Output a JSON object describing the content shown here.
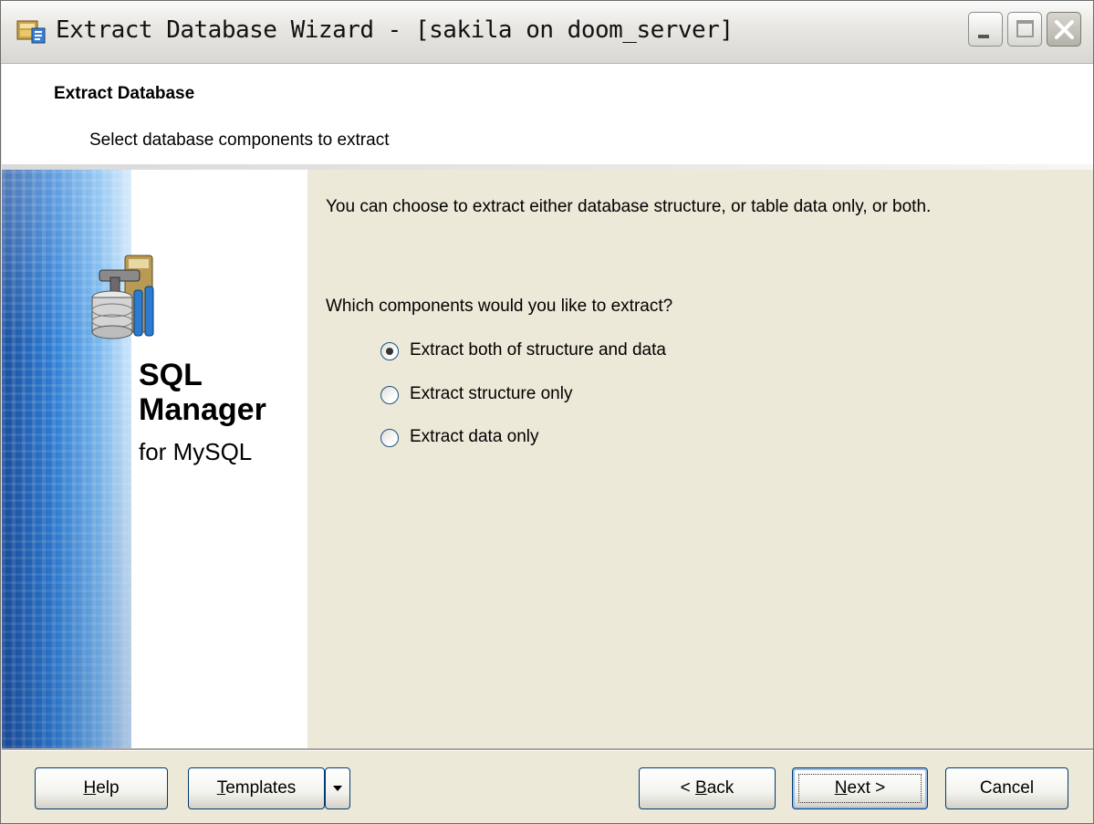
{
  "window": {
    "title": "Extract Database Wizard - [sakila on doom_server]"
  },
  "header": {
    "title": "Extract Database",
    "subtitle": "Select database components to extract"
  },
  "sidebar": {
    "logo_line1": "SQL",
    "logo_line2": "Manager",
    "logo_line3": "for MySQL"
  },
  "content": {
    "intro": "You can choose to extract either database structure, or table data only, or both.",
    "question": "Which components would you like to extract?",
    "options": [
      {
        "label": "Extract both of structure and data",
        "checked": true
      },
      {
        "label": "Extract structure only",
        "checked": false
      },
      {
        "label": "Extract data only",
        "checked": false
      }
    ]
  },
  "footer": {
    "help": {
      "pre": "",
      "key": "H",
      "post": "elp"
    },
    "templates": {
      "pre": "",
      "key": "T",
      "post": "emplates"
    },
    "back": {
      "pre": "< ",
      "key": "B",
      "post": "ack"
    },
    "next": {
      "pre": "",
      "key": "N",
      "post": "ext >"
    },
    "cancel": "Cancel"
  }
}
